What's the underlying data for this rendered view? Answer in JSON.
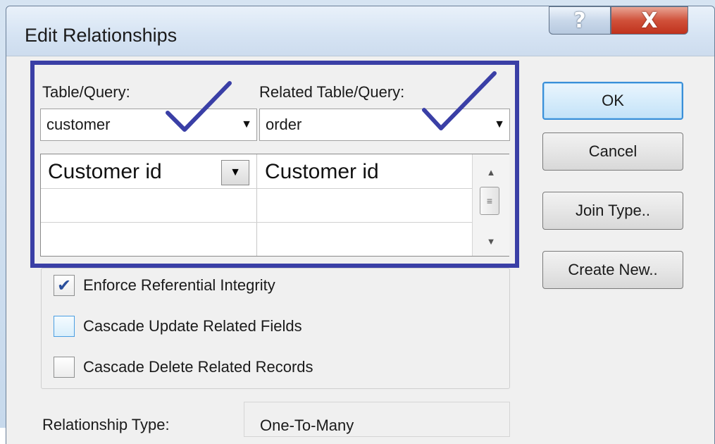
{
  "window": {
    "title": "Edit Relationships",
    "help_glyph": "?",
    "close_glyph": "X"
  },
  "table_query": {
    "label": "Table/Query:",
    "value": "customer"
  },
  "related_table_query": {
    "label": "Related Table/Query:",
    "value": "order"
  },
  "fields_grid": {
    "rows": [
      {
        "left": "Customer id",
        "right": "Customer id"
      },
      {
        "left": "",
        "right": ""
      },
      {
        "left": "",
        "right": ""
      }
    ]
  },
  "buttons": {
    "ok": "OK",
    "cancel": "Cancel",
    "join_type": "Join Type..",
    "create_new": "Create New.."
  },
  "options": {
    "enforce_referential_integrity": {
      "label": "Enforce Referential Integrity",
      "checked": true
    },
    "cascade_update": {
      "label": "Cascade Update Related Fields",
      "checked": false
    },
    "cascade_delete": {
      "label": "Cascade Delete Related Records",
      "checked": false
    }
  },
  "relationship_type": {
    "label": "Relationship Type:",
    "value": "One-To-Many"
  },
  "annotations": {
    "highlight_color": "#3a3fa6",
    "checkmark_color": "#3a3fa6"
  },
  "icons": {
    "dropdown": "▼",
    "scroll_up": "▲",
    "scroll_down": "▼",
    "scroll_grip": "≡",
    "checkbox_tick": "✔"
  }
}
